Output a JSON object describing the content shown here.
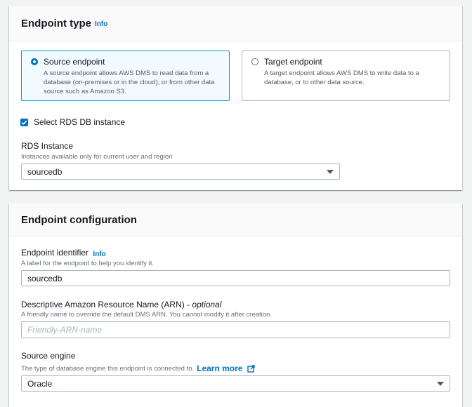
{
  "endpoint_type": {
    "title": "Endpoint type",
    "info": "Info",
    "source": {
      "label": "Source endpoint",
      "description": "A source endpoint allows AWS DMS to read data from a database (on-premises or in the cloud), or from other data source such as Amazon S3.",
      "selected": true
    },
    "target": {
      "label": "Target endpoint",
      "description": "A target endpoint allows AWS DMS to write data to a database, or to other data source.",
      "selected": false
    },
    "rds_checkbox": {
      "label": "Select RDS DB instance",
      "checked": true
    },
    "rds_instance": {
      "label": "RDS Instance",
      "description": "Instances available only for current user and region",
      "value": "sourcedb"
    }
  },
  "endpoint_config": {
    "title": "Endpoint configuration",
    "identifier": {
      "label": "Endpoint identifier",
      "info": "Info",
      "description": "A label for the endpoint to help you identify it.",
      "value": "sourcedb"
    },
    "arn": {
      "label": "Descriptive Amazon Resource Name (ARN) - ",
      "optional": "optional",
      "description": "A friendly name to override the default DMS ARN. You cannot modify it after creation.",
      "placeholder": "Friendly-ARN-name"
    },
    "engine": {
      "label": "Source engine",
      "description": "The type of database engine this endpoint is connected to.",
      "learn_more": "Learn more",
      "value": "Oracle"
    }
  },
  "colors": {
    "accent": "#0073bb",
    "selected_border": "#00a1c9",
    "selected_bg": "#f1faff"
  },
  "icons": {
    "external_link": "external-link-icon",
    "dropdown": "caret-down-icon"
  }
}
